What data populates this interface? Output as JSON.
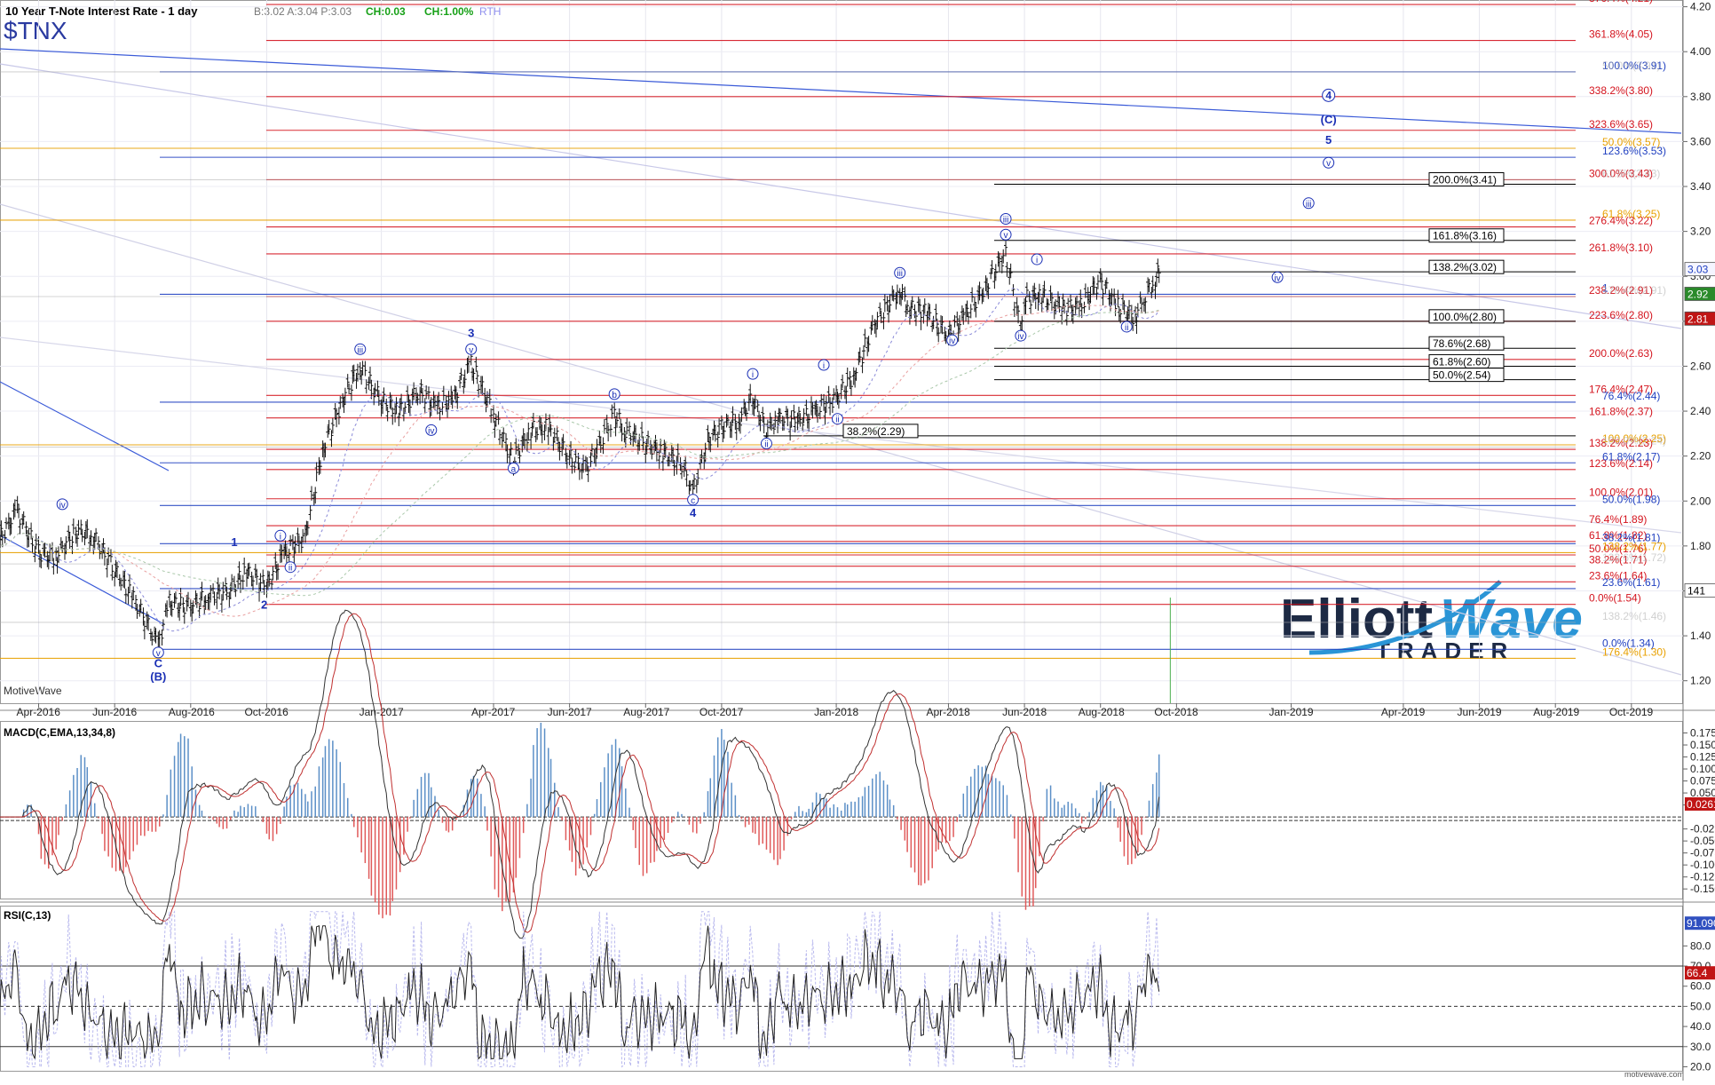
{
  "header": {
    "title": "10 Year T-Note Interest Rate - 1 day",
    "quote": "B:3.02  A:3.04  P:3.03",
    "change_abs": "CH:0.03",
    "change_pct": "CH:1.00%",
    "session": "RTH",
    "symbol": "$TNX"
  },
  "watermark": {
    "name_part1": "Elliott",
    "name_part2": "Wave",
    "sub": "TRADER",
    "platform": "MotiveWave",
    "footer": "motivewave.com"
  },
  "chart_data": [
    {
      "type": "ohlc",
      "panel": "price",
      "ylim": [
        1.1,
        4.23
      ],
      "yticks": [
        1.2,
        1.4,
        1.6,
        1.8,
        2.0,
        2.2,
        2.4,
        2.6,
        2.8,
        3.0,
        3.2,
        3.4,
        3.6,
        3.8,
        4.0,
        4.2
      ],
      "xlabels": [
        "Apr-2016",
        "Jun-2016",
        "Aug-2016",
        "Oct-2016",
        "Jan-2017",
        "Apr-2017",
        "Jun-2017",
        "Aug-2017",
        "Oct-2017",
        "Jan-2018",
        "Apr-2018",
        "Jun-2018",
        "Aug-2018",
        "Oct-2018",
        "Jan-2019",
        "Apr-2019",
        "Jun-2019",
        "Aug-2019",
        "Oct-2019"
      ],
      "xlabel_dates": [
        "2016-04-01",
        "2016-06-01",
        "2016-08-01",
        "2016-10-01",
        "2017-01-01",
        "2017-04-01",
        "2017-06-01",
        "2017-08-01",
        "2017-10-01",
        "2018-01-01",
        "2018-04-01",
        "2018-06-01",
        "2018-08-01",
        "2018-10-01",
        "2019-01-01",
        "2019-04-01",
        "2019-06-01",
        "2019-08-01",
        "2019-10-01"
      ],
      "x_range": [
        "2016-03-01",
        "2019-11-10"
      ],
      "series": [
        {
          "name": "$TNX",
          "close": [
            [
              "2016-03-01",
              1.83
            ],
            [
              "2016-03-15",
              1.96
            ],
            [
              "2016-04-01",
              1.77
            ],
            [
              "2016-04-15",
              1.75
            ],
            [
              "2016-05-01",
              1.87
            ],
            [
              "2016-05-15",
              1.85
            ],
            [
              "2016-06-01",
              1.7
            ],
            [
              "2016-06-15",
              1.58
            ],
            [
              "2016-06-27",
              1.46
            ],
            [
              "2016-07-06",
              1.36
            ],
            [
              "2016-07-15",
              1.55
            ],
            [
              "2016-08-01",
              1.53
            ],
            [
              "2016-08-15",
              1.58
            ],
            [
              "2016-09-01",
              1.6
            ],
            [
              "2016-09-15",
              1.69
            ],
            [
              "2016-10-01",
              1.62
            ],
            [
              "2016-10-15",
              1.77
            ],
            [
              "2016-11-01",
              1.84
            ],
            [
              "2016-11-15",
              2.22
            ],
            [
              "2016-12-01",
              2.45
            ],
            [
              "2016-12-15",
              2.6
            ],
            [
              "2017-01-01",
              2.45
            ],
            [
              "2017-01-15",
              2.4
            ],
            [
              "2017-02-01",
              2.49
            ],
            [
              "2017-02-15",
              2.42
            ],
            [
              "2017-03-01",
              2.46
            ],
            [
              "2017-03-14",
              2.62
            ],
            [
              "2017-04-01",
              2.39
            ],
            [
              "2017-04-17",
              2.18
            ],
            [
              "2017-05-01",
              2.32
            ],
            [
              "2017-05-15",
              2.33
            ],
            [
              "2017-06-01",
              2.2
            ],
            [
              "2017-06-14",
              2.14
            ],
            [
              "2017-07-01",
              2.31
            ],
            [
              "2017-07-07",
              2.39
            ],
            [
              "2017-07-15",
              2.32
            ],
            [
              "2017-08-01",
              2.26
            ],
            [
              "2017-08-15",
              2.22
            ],
            [
              "2017-09-01",
              2.16
            ],
            [
              "2017-09-08",
              2.04
            ],
            [
              "2017-09-20",
              2.27
            ],
            [
              "2017-10-01",
              2.33
            ],
            [
              "2017-10-15",
              2.36
            ],
            [
              "2017-10-26",
              2.46
            ],
            [
              "2017-11-06",
              2.32
            ],
            [
              "2017-11-15",
              2.37
            ],
            [
              "2017-12-01",
              2.36
            ],
            [
              "2017-12-15",
              2.4
            ],
            [
              "2018-01-01",
              2.46
            ],
            [
              "2018-01-15",
              2.55
            ],
            [
              "2018-02-01",
              2.79
            ],
            [
              "2018-02-21",
              2.94
            ],
            [
              "2018-03-01",
              2.86
            ],
            [
              "2018-03-15",
              2.84
            ],
            [
              "2018-04-01",
              2.74
            ],
            [
              "2018-04-15",
              2.83
            ],
            [
              "2018-05-01",
              2.95
            ],
            [
              "2018-05-17",
              3.11
            ],
            [
              "2018-05-29",
              2.77
            ],
            [
              "2018-06-01",
              2.9
            ],
            [
              "2018-06-15",
              2.92
            ],
            [
              "2018-07-01",
              2.86
            ],
            [
              "2018-07-15",
              2.86
            ],
            [
              "2018-08-01",
              2.98
            ],
            [
              "2018-08-15",
              2.87
            ],
            [
              "2018-08-29",
              2.82
            ],
            [
              "2018-09-05",
              2.9
            ],
            [
              "2018-09-14",
              2.99
            ],
            [
              "2018-09-19",
              3.03
            ]
          ]
        }
      ],
      "horizontal_levels": [
        {
          "label": "376.4%(4.21)",
          "value": 4.21,
          "color": "#d4141e",
          "group": "red"
        },
        {
          "label": "361.8%(4.05)",
          "value": 4.05,
          "color": "#d4141e",
          "group": "red"
        },
        {
          "label": "338.2%(3.80)",
          "value": 3.8,
          "color": "#d4141e",
          "group": "red"
        },
        {
          "label": "323.6%(3.65)",
          "value": 3.65,
          "color": "#d4141e",
          "group": "red"
        },
        {
          "label": "300.0%(3.43)",
          "value": 3.43,
          "color": "#d4141e",
          "group": "red"
        },
        {
          "label": "276.4%(3.22)",
          "value": 3.22,
          "color": "#d4141e",
          "group": "red"
        },
        {
          "label": "261.8%(3.10)",
          "value": 3.1,
          "color": "#d4141e",
          "group": "red"
        },
        {
          "label": "238.2%(2.91)",
          "value": 2.91,
          "color": "#d4141e",
          "group": "red"
        },
        {
          "label": "223.6%(2.80)",
          "value": 2.8,
          "color": "#d4141e",
          "group": "red"
        },
        {
          "label": "200.0%(2.63)",
          "value": 2.63,
          "color": "#d4141e",
          "group": "red"
        },
        {
          "label": "176.4%(2.47)",
          "value": 2.47,
          "color": "#d4141e",
          "group": "red"
        },
        {
          "label": "161.8%(2.37)",
          "value": 2.37,
          "color": "#d4141e",
          "group": "red"
        },
        {
          "label": "138.2%(2.23)",
          "value": 2.23,
          "color": "#d4141e",
          "group": "red"
        },
        {
          "label": "123.6%(2.14)",
          "value": 2.14,
          "color": "#d4141e",
          "group": "red"
        },
        {
          "label": "100.0%(2.01)",
          "value": 2.01,
          "color": "#d4141e",
          "group": "red"
        },
        {
          "label": "76.4%(1.89)",
          "value": 1.89,
          "color": "#d4141e",
          "group": "red"
        },
        {
          "label": "61.8%(1.82)",
          "value": 1.82,
          "color": "#d4141e",
          "group": "red"
        },
        {
          "label": "50.0%(1.76)",
          "value": 1.76,
          "color": "#d4141e",
          "group": "red"
        },
        {
          "label": "38.2%(1.71)",
          "value": 1.71,
          "color": "#d4141e",
          "group": "red"
        },
        {
          "label": "23.6%(1.64)",
          "value": 1.64,
          "color": "#d4141e",
          "group": "red"
        },
        {
          "label": "0.0%(1.54)",
          "value": 1.54,
          "color": "#d4141e",
          "group": "red"
        },
        {
          "label": "123.6%(3.53)",
          "value": 3.53,
          "color": "#2040c0",
          "group": "blue"
        },
        {
          "label": "76.4%(2.44)",
          "value": 2.44,
          "color": "#2040c0",
          "group": "blue"
        },
        {
          "label": "61.8%(2.17)",
          "value": 2.17,
          "color": "#2040c0",
          "group": "blue"
        },
        {
          "label": "50.0%(1.98)",
          "value": 1.98,
          "color": "#2040c0",
          "group": "blue"
        },
        {
          "label": "38.2%(1.81)",
          "value": 1.81,
          "color": "#2040c0",
          "group": "blue"
        },
        {
          "label": "23.6%(1.61)",
          "value": 1.61,
          "color": "#2040c0",
          "group": "blue"
        },
        {
          "label": "0.0%(1.34)",
          "value": 1.34,
          "color": "#2040c0",
          "group": "blue"
        },
        {
          "label": "1",
          "value": 2.92,
          "color": "#2040c0",
          "group": "blue"
        },
        {
          "label": "100.0%(2.25)",
          "value": 2.25,
          "color": "#e8a000",
          "group": "gold"
        },
        {
          "label": "100.0%(2.24)",
          "value": 2.24,
          "color": "#aaaaaa",
          "group": "grey"
        },
        {
          "label": "138.2%(1.77)",
          "value": 1.77,
          "color": "#e8a000",
          "group": "gold"
        },
        {
          "label": "123.6%(1.72)",
          "value": 1.72,
          "color": "#aaaaaa",
          "group": "grey"
        },
        {
          "label": "138.2%(1.46)",
          "value": 1.46,
          "color": "#aaaaaa",
          "group": "grey"
        },
        {
          "label": "176.4%(1.30)",
          "value": 1.3,
          "color": "#e8a000",
          "group": "gold"
        },
        {
          "label": "61.8%(3.25)",
          "value": 3.25,
          "color": "#e8a000",
          "group": "gold"
        },
        {
          "label": "50.0%(3.57)",
          "value": 3.57,
          "color": "#e8a000",
          "group": "gold"
        },
        {
          "label": "61.8%(3.43)",
          "value": 3.43,
          "color": "#aaaaaa",
          "group": "grey"
        },
        {
          "label": "176.4%(2.91)",
          "value": 2.91,
          "color": "#aaaaaa",
          "group": "grey"
        },
        {
          "label": "100.0%(3.91)",
          "value": 3.91,
          "color": "#2040c0",
          "group": "blue"
        },
        {
          "label": "50.0%(3.91)",
          "value": 3.91,
          "color": "#aaaaaa",
          "group": "grey"
        }
      ],
      "black_levels": [
        {
          "label": "200.0%(3.41)",
          "value": 3.41
        },
        {
          "label": "161.8%(3.16)",
          "value": 3.16
        },
        {
          "label": "138.2%(3.02)",
          "value": 3.02
        },
        {
          "label": "100.0%(2.80)",
          "value": 2.8
        },
        {
          "label": "78.6%(2.68)",
          "value": 2.68
        },
        {
          "label": "61.8%(2.60)",
          "value": 2.6
        },
        {
          "label": "50.0%(2.54)",
          "value": 2.54
        },
        {
          "label": "38.2%(2.29)",
          "value": 2.29
        }
      ],
      "wave_labels": [
        {
          "t": "iv",
          "date": "2016-04-20",
          "value": 1.97,
          "circled": true
        },
        {
          "t": "v",
          "date": "2016-07-06",
          "value": 1.31,
          "circled": true
        },
        {
          "t": "C",
          "date": "2016-07-06",
          "value": 1.26,
          "circled": false
        },
        {
          "t": "(B)",
          "date": "2016-07-06",
          "value": 1.2,
          "circled": false
        },
        {
          "t": "1",
          "date": "2016-09-05",
          "value": 1.8,
          "circled": false
        },
        {
          "t": "i",
          "date": "2016-10-12",
          "value": 1.83,
          "circled": true
        },
        {
          "t": "ii",
          "date": "2016-10-20",
          "value": 1.69,
          "circled": true
        },
        {
          "t": "2",
          "date": "2016-09-29",
          "value": 1.52,
          "circled": false
        },
        {
          "t": "iii",
          "date": "2016-12-15",
          "value": 2.66,
          "circled": true
        },
        {
          "t": "iv",
          "date": "2017-02-10",
          "value": 2.3,
          "circled": true
        },
        {
          "t": "3",
          "date": "2017-03-14",
          "value": 2.73,
          "circled": false
        },
        {
          "t": "v",
          "date": "2017-03-14",
          "value": 2.66,
          "circled": true
        },
        {
          "t": "a",
          "date": "2017-04-17",
          "value": 2.13,
          "circled": true
        },
        {
          "t": "b",
          "date": "2017-07-07",
          "value": 2.46,
          "circled": true
        },
        {
          "t": "c",
          "date": "2017-09-08",
          "value": 1.99,
          "circled": true
        },
        {
          "t": "4",
          "date": "2017-09-08",
          "value": 1.93,
          "circled": false
        },
        {
          "t": "i",
          "date": "2017-10-26",
          "value": 2.55,
          "circled": true
        },
        {
          "t": "ii",
          "date": "2017-11-06",
          "value": 2.24,
          "circled": true
        },
        {
          "t": "i",
          "date": "2017-12-22",
          "value": 2.59,
          "circled": true
        },
        {
          "t": "ii",
          "date": "2018-01-02",
          "value": 2.35,
          "circled": true
        },
        {
          "t": "iii",
          "date": "2018-02-21",
          "value": 3.0,
          "circled": true
        },
        {
          "t": "iv",
          "date": "2018-04-04",
          "value": 2.7,
          "circled": true
        },
        {
          "t": "v",
          "date": "2018-05-17",
          "value": 3.17,
          "circled": true
        },
        {
          "t": "iii",
          "date": "2018-05-17",
          "value": 3.24,
          "circled": true
        },
        {
          "t": "iv",
          "date": "2018-05-29",
          "value": 2.72,
          "circled": true
        },
        {
          "t": "i",
          "date": "2018-06-11",
          "value": 3.06,
          "circled": true
        },
        {
          "t": "ii",
          "date": "2018-08-22",
          "value": 2.76,
          "circled": true
        },
        {
          "t": "iii",
          "date": "2019-01-15",
          "value": 3.31,
          "circled": true
        },
        {
          "t": "iv",
          "date": "2018-12-21",
          "value": 2.98,
          "circled": true
        },
        {
          "t": "v",
          "date": "2019-01-31",
          "value": 3.49,
          "circled": true
        },
        {
          "t": "5",
          "date": "2019-01-31",
          "value": 3.59,
          "circled": false
        },
        {
          "t": "(C)",
          "date": "2019-01-31",
          "value": 3.68,
          "circled": false
        },
        {
          "t": "4",
          "date": "2019-01-31",
          "value": 3.79,
          "circled": true
        }
      ],
      "last_price": {
        "value": "3.03",
        "ma1": "2.92",
        "ma2": "2.81",
        "bars": "141"
      }
    },
    {
      "type": "macd",
      "panel": "macd",
      "title": "MACD(C,EMA,13,34,8)",
      "ylim": [
        -0.17,
        0.2
      ],
      "yticks": [
        "0.1750",
        "0.1500",
        "0.1250",
        "0.1000",
        "0.0750",
        "0.0500",
        "0.0250",
        "-0.0250",
        "-0.0500",
        "-0.0750",
        "-0.1000",
        "-0.1250",
        "-0.1500"
      ],
      "ytick_values": [
        0.175,
        0.15,
        0.125,
        0.1,
        0.075,
        0.05,
        0.025,
        -0.025,
        -0.05,
        -0.075,
        -0.1,
        -0.125,
        -0.15
      ],
      "last": "0.0261"
    },
    {
      "type": "rsi",
      "panel": "rsi",
      "title": "RSI(C,13)",
      "ylim": [
        18,
        100
      ],
      "yticks": [
        "80.0",
        "70.0",
        "60.0",
        "50.0",
        "40.0",
        "30.0",
        "20.0"
      ],
      "ytick_values": [
        80,
        70,
        60,
        50,
        40,
        30,
        20
      ],
      "levels": [
        70,
        50,
        30
      ],
      "last": "66.4",
      "last2": "91.0903"
    }
  ],
  "colors": {
    "ohlc": "#111111",
    "red_fib": "#d4141e",
    "blue_fib": "#2040c0",
    "gold_fib": "#e8a000",
    "macd_pos": "#5b8fc7",
    "macd_neg": "#e05a5a",
    "wave": "#1a2fb5"
  }
}
